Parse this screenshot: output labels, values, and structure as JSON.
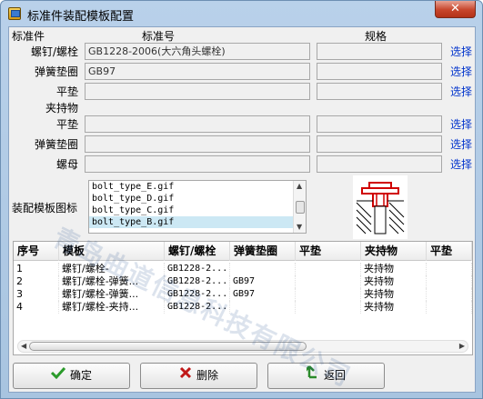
{
  "window": {
    "title": "标准件装配模板配置",
    "close_glyph": "✕"
  },
  "form": {
    "header_standard_part": "标准件",
    "header_standard_no": "标准号",
    "header_spec": "规格",
    "rows": [
      {
        "label": "螺钉/螺栓",
        "std": "GB1228-2006(大六角头螺栓)",
        "spec": "",
        "action": "选择"
      },
      {
        "label": "弹簧垫圈",
        "std": "GB97",
        "spec": "",
        "action": "选择"
      },
      {
        "label": "平垫",
        "std": "",
        "spec": "",
        "action": "选择"
      },
      {
        "label": "夹持物",
        "std": "",
        "spec": "",
        "action": ""
      },
      {
        "label": "平垫",
        "std": "",
        "spec": "",
        "action": "选择"
      },
      {
        "label": "弹簧垫圈",
        "std": "",
        "spec": "",
        "action": "选择"
      },
      {
        "label": "螺母",
        "std": "",
        "spec": "",
        "action": "选择"
      }
    ],
    "template_icon_label": "装配模板图标",
    "template_icons": [
      "bolt_type_E.gif",
      "bolt_type_D.gif",
      "bolt_type_C.gif",
      "bolt_type_B.gif"
    ],
    "selected_icon": "bolt_type_B.gif"
  },
  "table": {
    "columns": [
      "序号",
      "模板",
      "螺钉/螺栓",
      "弹簧垫圈",
      "平垫",
      "夹持物",
      "平垫"
    ],
    "rows": [
      [
        "1",
        "螺钉/螺栓-",
        "GB1228-2...",
        "",
        "",
        "夹持物",
        ""
      ],
      [
        "2",
        "螺钉/螺栓-弹簧...",
        "GB1228-2...",
        "GB97",
        "",
        "夹持物",
        ""
      ],
      [
        "3",
        "螺钉/螺栓-弹簧...",
        "GB1228-2...",
        "GB97",
        "",
        "夹持物",
        ""
      ],
      [
        "4",
        "螺钉/螺栓-夹持...",
        "GB1228-2...",
        "",
        "",
        "夹持物",
        ""
      ]
    ]
  },
  "buttons": {
    "confirm": "确定",
    "delete": "删除",
    "back": "返回"
  },
  "watermark": "青岛曲道信息科技有限公司",
  "colors": {
    "link": "#0033cc",
    "confirm_icon": "#2a9a2a",
    "delete_icon": "#c01818",
    "back_icon": "#2a8a2a",
    "preview_red": "#d00000"
  },
  "icons": {
    "app": "app-window-icon",
    "confirm": "checkmark-icon",
    "delete": "cross-icon",
    "back": "return-arrow-icon"
  }
}
